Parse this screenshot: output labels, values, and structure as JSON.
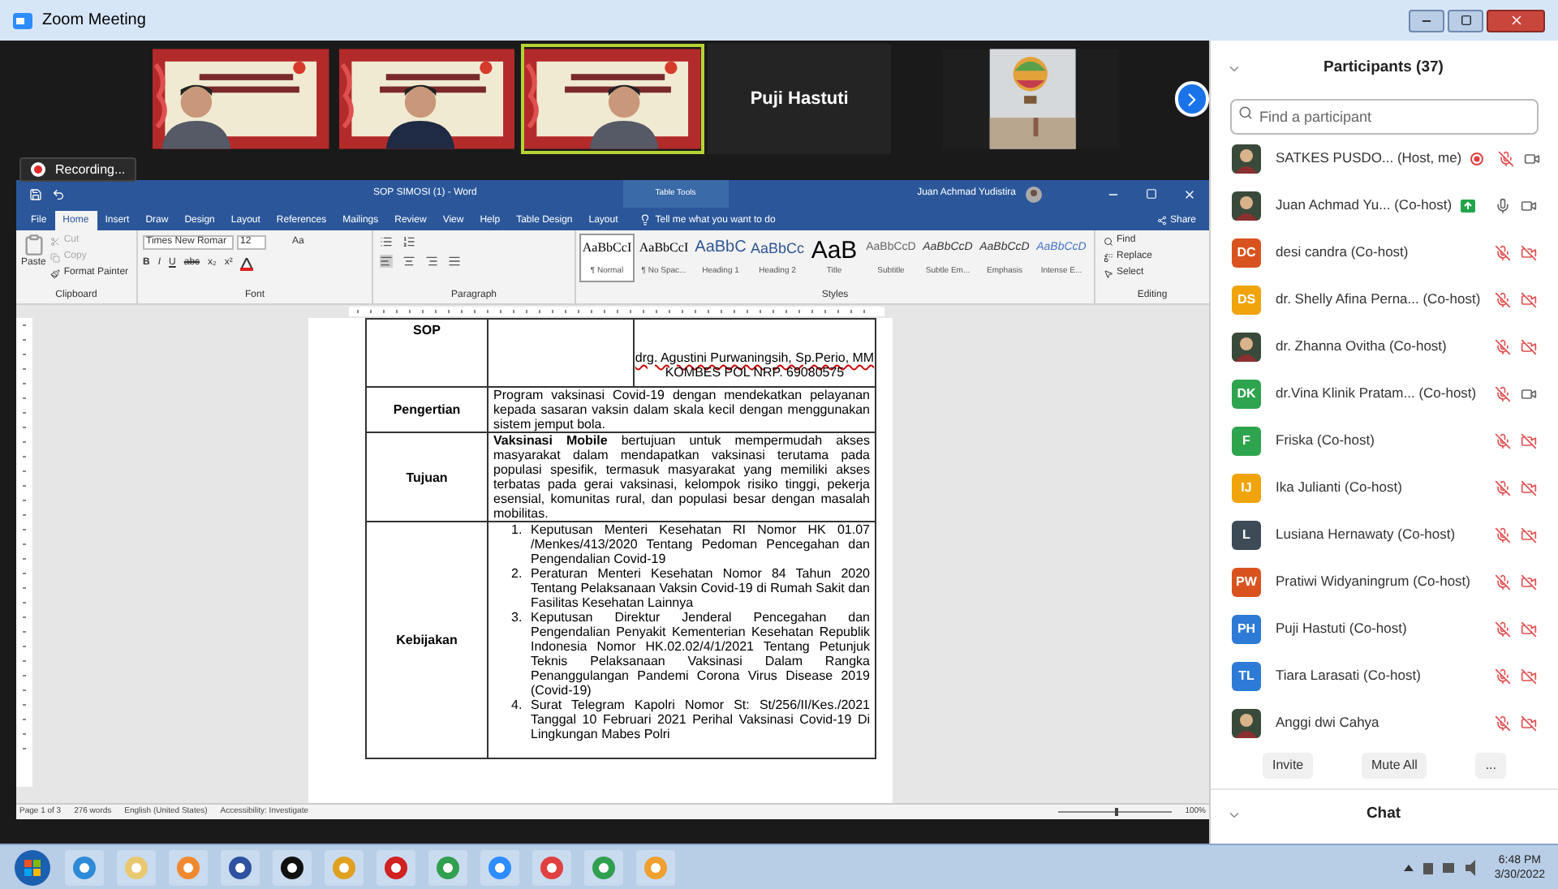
{
  "window": {
    "title": "Zoom Meeting"
  },
  "video_strip": {
    "tiles": [
      {
        "kind": "picture",
        "speaking": false
      },
      {
        "kind": "picture",
        "speaking": false
      },
      {
        "kind": "picture",
        "speaking": true
      },
      {
        "kind": "name",
        "name": "Puji Hastuti",
        "speaking": false
      },
      {
        "kind": "picture",
        "speaking": false
      }
    ]
  },
  "recording": {
    "label": "Recording..."
  },
  "word": {
    "title": "SOP SIMOSI (1)  -  Word",
    "context_tab": "Table Tools",
    "user": "Juan Achmad Yudistira",
    "tabs": [
      {
        "label": "File",
        "selected": false
      },
      {
        "label": "Home",
        "selected": true
      },
      {
        "label": "Insert",
        "selected": false
      },
      {
        "label": "Draw",
        "selected": false
      },
      {
        "label": "Design",
        "selected": false
      },
      {
        "label": "Layout",
        "selected": false
      },
      {
        "label": "References",
        "selected": false
      },
      {
        "label": "Mailings",
        "selected": false
      },
      {
        "label": "Review",
        "selected": false
      },
      {
        "label": "View",
        "selected": false
      },
      {
        "label": "Help",
        "selected": false
      },
      {
        "label": "Table Design",
        "selected": false
      },
      {
        "label": "Layout",
        "selected": false
      }
    ],
    "tell_me": "Tell me what you want to do",
    "share": "Share",
    "ribbon": {
      "clipboard": {
        "paste": "Paste",
        "items": [
          "Cut",
          "Copy",
          "Format Painter"
        ],
        "label": "Clipboard"
      },
      "font": {
        "name": "Times New Romar",
        "size": "12",
        "case": "Aa",
        "format": [
          "B",
          "I",
          "U",
          "abc",
          "x₂",
          "x²"
        ],
        "label": "Font"
      },
      "paragraph": {
        "label": "Paragraph"
      },
      "styles": {
        "items": [
          {
            "sample": "AaBbCcI",
            "name": "¶ Normal",
            "kind": "normal",
            "selected": true
          },
          {
            "sample": "AaBbCcI",
            "name": "¶ No Spac...",
            "kind": "normal",
            "selected": false
          },
          {
            "sample": "AaBbC",
            "name": "Heading 1",
            "kind": "heading1",
            "selected": false
          },
          {
            "sample": "AaBbCc",
            "name": "Heading 2",
            "kind": "heading2",
            "selected": false
          },
          {
            "sample": "AaB",
            "name": "Title",
            "kind": "title",
            "selected": false
          },
          {
            "sample": "AaBbCcD",
            "name": "Subtitle",
            "kind": "subtitle",
            "selected": false
          },
          {
            "sample": "AaBbCcD",
            "name": "Subtle Em...",
            "kind": "emphasis",
            "selected": false
          },
          {
            "sample": "AaBbCcD",
            "name": "Emphasis",
            "kind": "emphasis",
            "selected": false
          },
          {
            "sample": "AaBbCcD",
            "name": "Intense E...",
            "kind": "intense",
            "selected": false
          }
        ],
        "label": "Styles"
      },
      "editing": {
        "items": [
          "Find",
          "Replace",
          "Select"
        ],
        "label": "Editing"
      }
    },
    "document": {
      "rows": [
        {
          "kind": "signature",
          "header": "SOP",
          "lines": [
            "drg. Agustini Purwaningsih, Sp.Perio, MM",
            "KOMBES POL NRP. 69080575"
          ]
        },
        {
          "kind": "text",
          "header": "Pengertian",
          "text": "Program vaksinasi Covid-19 dengan mendekatkan pelayanan kepada sasaran vaksin dalam skala kecil dengan menggunakan sistem jemput bola."
        },
        {
          "kind": "text",
          "header": "Tujuan",
          "text": "**Vaksinasi Mobile** bertujuan untuk mempermudah akses masyarakat dalam mendapatkan vaksinasi terutama pada populasi spesifik, termasuk masyarakat yang memiliki akses terbatas pada gerai vaksinasi, kelompok risiko tinggi, pekerja esensial, komunitas rural, dan populasi besar dengan masalah mobilitas."
        },
        {
          "kind": "list",
          "header": "Kebijakan",
          "items": [
            {
              "number": "1.",
              "text": "Keputusan Menteri Kesehatan RI Nomor HK 01.07 /Menkes/413/2020 Tentang Pedoman Pencegahan dan Pengendalian Covid-19"
            },
            {
              "number": "2.",
              "text": "Peraturan Menteri Kesehatan Nomor 84 Tahun 2020 Tentang Pelaksanaan Vaksin Covid-19 di Rumah Sakit dan Fasilitas Kesehatan Lainnya"
            },
            {
              "number": "3.",
              "text": "Keputusan Direktur Jenderal Pencegahan dan Pengendalian Penyakit Kementerian Kesehatan Republik Indonesia Nomor HK.02.02/4/1/2021 Tentang Petunjuk Teknis Pelaksanaan Vaksinasi Dalam Rangka Penanggulangan Pandemi Corona Virus Disease 2019 (Covid-19)"
            },
            {
              "number": "4.",
              "text": "Surat Telegram Kapolri Nomor St: St/256/II/Kes./2021 Tanggal 10 Februari 2021 Perihal Vaksinasi Covid-19 Di Lingkungan Mabes Polri"
            }
          ]
        }
      ]
    },
    "status_bar": [
      "Page 1 of 3",
      "276 words",
      "English (United States)",
      "Accessibility: Investigate"
    ],
    "zoom": {
      "label": "100%",
      "level": 0.5
    }
  },
  "participants": {
    "title": "Participants (37)",
    "search": {
      "placeholder": "Find a participant"
    },
    "items": [
      {
        "name": "SATKES PUSDO...",
        "role": "(Host, me)",
        "recording": true,
        "sharing": false,
        "muted": true,
        "video_on": true
      },
      {
        "name": "Juan Achmad Yu...",
        "role": "(Co-host)",
        "recording": false,
        "sharing": true,
        "muted": false,
        "video_on": true
      },
      {
        "name": "desi candra",
        "role": "(Co-host)",
        "kind": "initials",
        "initials": "DC",
        "color": "#d9531e",
        "recording": false,
        "sharing": false,
        "muted": true,
        "video_on": false
      },
      {
        "name": "dr. Shelly Afina Perna...",
        "role": "(Co-host)",
        "kind": "initials",
        "initials": "DS",
        "color": "#f0a30a",
        "recording": false,
        "sharing": false,
        "muted": true,
        "video_on": false
      },
      {
        "name": "dr. Zhanna Ovitha",
        "role": "(Co-host)",
        "recording": false,
        "sharing": false,
        "muted": true,
        "video_on": false
      },
      {
        "name": "dr.Vina Klinik Pratam...",
        "role": "(Co-host)",
        "kind": "initials",
        "initials": "DK",
        "color": "#2ea44f",
        "recording": false,
        "sharing": false,
        "muted": true,
        "video_on": true
      },
      {
        "name": "Friska",
        "role": "(Co-host)",
        "kind": "initials",
        "initials": "F",
        "color": "#2ea44f",
        "recording": false,
        "sharing": false,
        "muted": true,
        "video_on": false
      },
      {
        "name": "Ika Julianti",
        "role": "(Co-host)",
        "kind": "initials",
        "initials": "IJ",
        "color": "#f0a30a",
        "recording": false,
        "sharing": false,
        "muted": true,
        "video_on": false
      },
      {
        "name": "Lusiana Hernawaty",
        "role": "(Co-host)",
        "kind": "initials",
        "initials": "L",
        "color": "#3d4b57",
        "recording": false,
        "sharing": false,
        "muted": true,
        "video_on": false
      },
      {
        "name": "Pratiwi Widyaningrum",
        "role": "(Co-host)",
        "kind": "initials",
        "initials": "PW",
        "color": "#d9531e",
        "recording": false,
        "sharing": false,
        "muted": true,
        "video_on": false
      },
      {
        "name": "Puji Hastuti",
        "role": "(Co-host)",
        "kind": "initials",
        "initials": "PH",
        "color": "#2d7bd6",
        "recording": false,
        "sharing": false,
        "muted": true,
        "video_on": false
      },
      {
        "name": "Tiara Larasati",
        "role": "(Co-host)",
        "kind": "initials",
        "initials": "TL",
        "color": "#2d7bd6",
        "recording": false,
        "sharing": false,
        "muted": true,
        "video_on": false
      },
      {
        "name": "Anggi dwi Cahya",
        "recording": false,
        "sharing": false,
        "muted": true,
        "video_on": false
      }
    ],
    "buttons": [
      "Invite",
      "Mute All",
      "..."
    ]
  },
  "chat": {
    "title": "Chat"
  },
  "taskbar": {
    "time": "6:48 PM",
    "date": "3/30/2022"
  }
}
